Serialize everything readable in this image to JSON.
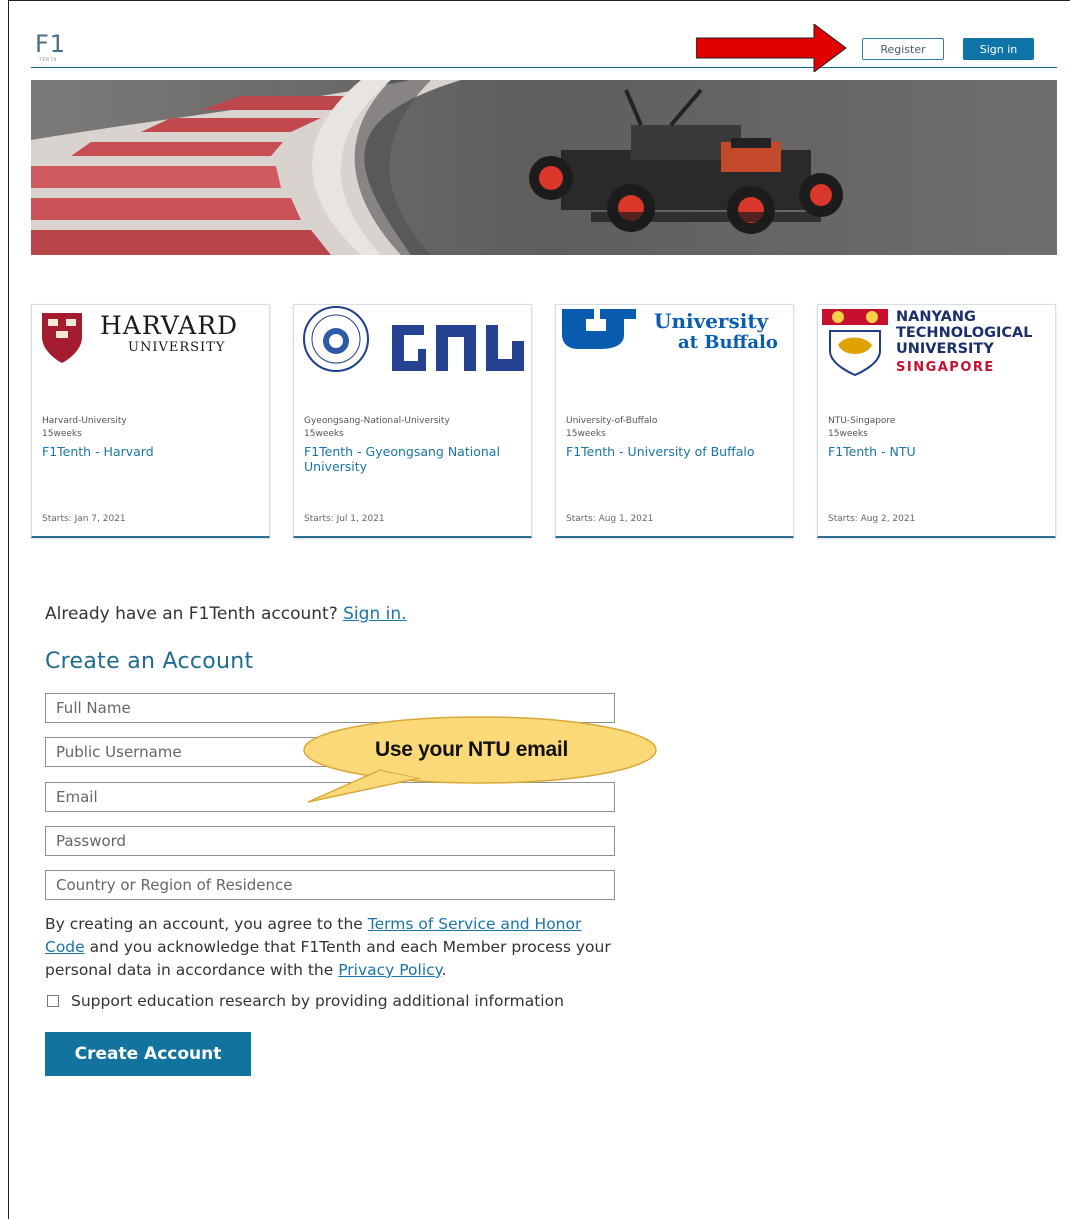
{
  "header": {
    "logo_text": "F1",
    "logo_sub": "TENTH",
    "register_label": "Register",
    "signin_label": "Sign in"
  },
  "courses": [
    {
      "logo_text": "HARVARD",
      "logo_sub": "UNIVERSITY",
      "org": "Harvard-University",
      "weeks": "15weeks",
      "title": "F1Tenth - Harvard",
      "starts": "Starts: Jan 7, 2021"
    },
    {
      "logo_text": "GNU",
      "logo_sub": "",
      "org": "Gyeongsang-National-University",
      "weeks": "15weeks",
      "title": "F1Tenth - Gyeongsang National University",
      "starts": "Starts: Jul 1, 2021"
    },
    {
      "logo_text": "University",
      "logo_sub": "at Buffalo",
      "org": "University-of-Buffalo",
      "weeks": "15weeks",
      "title": "F1Tenth - University of Buffalo",
      "starts": "Starts: Aug 1, 2021"
    },
    {
      "logo_text": "NANYANG",
      "logo_sub": "TECHNOLOGICAL",
      "logo_sub2": "UNIVERSITY",
      "logo_sub3": "SINGAPORE",
      "org": "NTU-Singapore",
      "weeks": "15weeks",
      "title": "F1Tenth - NTU",
      "starts": "Starts: Aug 2, 2021"
    }
  ],
  "form": {
    "already_prefix": "Already have an F1Tenth account?",
    "already_link": "Sign in.",
    "title": "Create an Account",
    "full_name_placeholder": "Full Name",
    "username_placeholder": "Public Username",
    "email_placeholder": "Email",
    "password_placeholder": "Password",
    "country_placeholder": "Country or Region of Residence",
    "callout": "Use your NTU email",
    "terms_prefix": "By creating an account, you agree to the",
    "terms_link": "Terms of Service and Honor Code",
    "terms_middle": "and you acknowledge that F1Tenth and each Member process your personal data in accordance with the",
    "privacy_link": "Privacy Policy",
    "terms_suffix": ".",
    "support_label": "Support education research by providing additional information",
    "create_button": "Create Account"
  },
  "colors": {
    "accent": "#12739f",
    "link": "#1a75a6",
    "arrow": "#e10000",
    "callout_fill": "#fcd978"
  }
}
